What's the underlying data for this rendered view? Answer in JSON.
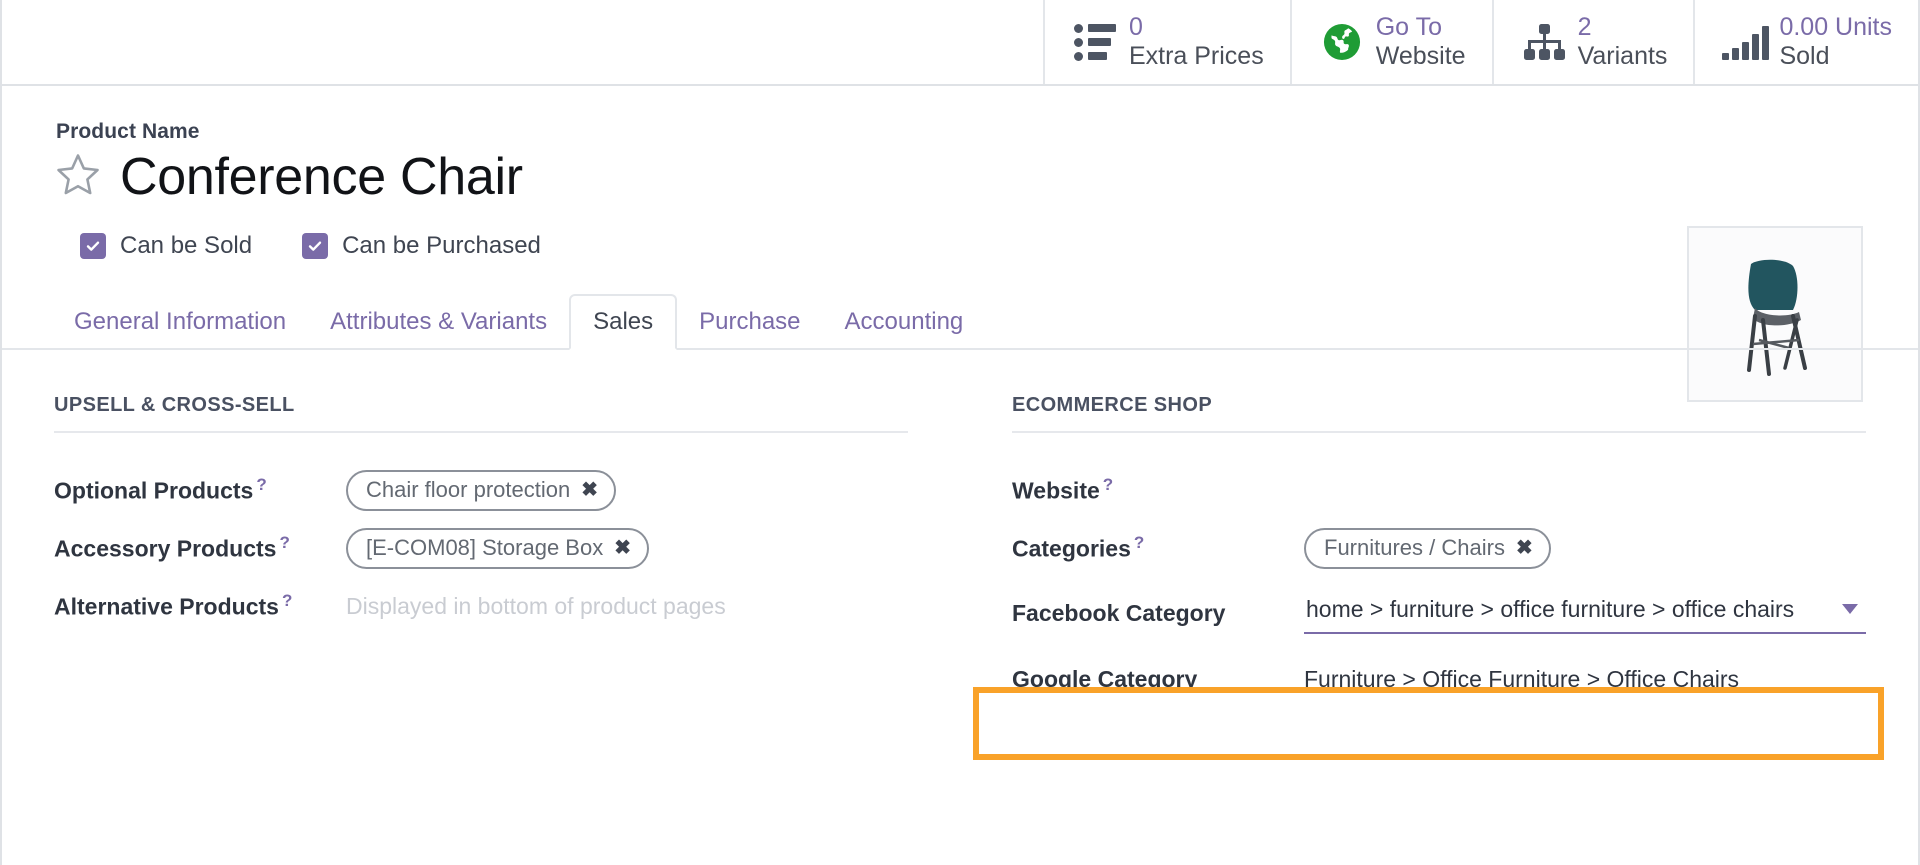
{
  "statbar": {
    "buttons": [
      {
        "icon": "list-icon",
        "value": "0",
        "label": "Extra Prices"
      },
      {
        "icon": "globe-icon",
        "value": "Go To",
        "label": "Website"
      },
      {
        "icon": "hierarchy-icon",
        "value": "2",
        "label": "Variants"
      },
      {
        "icon": "bar-chart-icon",
        "value": "0.00 Units",
        "label": "Sold"
      }
    ]
  },
  "form": {
    "name_label": "Product Name",
    "product_name": "Conference Chair",
    "favorite_icon": "star-outline-icon",
    "thumbnail_alt": "product-image-conference-chair",
    "checkboxes": [
      {
        "label": "Can be Sold",
        "checked": true
      },
      {
        "label": "Can be Purchased",
        "checked": true
      }
    ]
  },
  "tabs": [
    {
      "label": "General Information",
      "active": false
    },
    {
      "label": "Attributes & Variants",
      "active": false
    },
    {
      "label": "Sales",
      "active": true
    },
    {
      "label": "Purchase",
      "active": false
    },
    {
      "label": "Accounting",
      "active": false
    }
  ],
  "left_group": {
    "title": "UPSELL & CROSS-SELL",
    "rows": [
      {
        "label": "Optional Products",
        "help": "?",
        "type": "tag",
        "value": "Chair floor protection",
        "remove": "✖"
      },
      {
        "label": "Accessory Products",
        "help": "?",
        "type": "tag",
        "value": "[E-COM08] Storage Box",
        "remove": "✖"
      },
      {
        "label": "Alternative Products",
        "help": "?",
        "type": "placeholder",
        "value": "Displayed in bottom of product pages"
      }
    ]
  },
  "right_group": {
    "title": "ECOMMERCE SHOP",
    "rows": [
      {
        "label": "Website",
        "help": "?",
        "type": "empty",
        "value": ""
      },
      {
        "label": "Categories",
        "help": "?",
        "type": "tag",
        "value": "Furnitures / Chairs",
        "remove": "✖"
      },
      {
        "label": "Facebook Category",
        "help": "",
        "type": "select",
        "value": "home > furniture > office furniture > office chairs"
      },
      {
        "label": "Google Category",
        "help": "",
        "type": "plain",
        "value": "Furniture > Office Furniture > Office Chairs"
      }
    ]
  },
  "highlight": {
    "name": "facebook-category-highlight",
    "color": "#f9a229"
  },
  "colors": {
    "accent": "#7a6ba8",
    "text": "#2f3540",
    "muted": "#c9ccd2",
    "border": "#e3e6ea",
    "globe_green": "#1f9c35",
    "highlight_orange": "#f9a229"
  }
}
